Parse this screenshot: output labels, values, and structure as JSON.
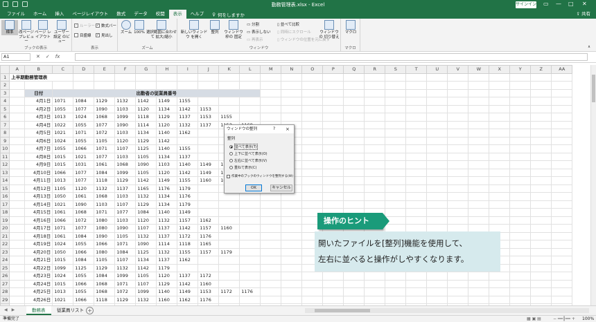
{
  "window": {
    "title": "勤務管理表.xlsx - Excel",
    "signin": "サインイン",
    "share": "共有"
  },
  "menu": {
    "tabs": [
      "ファイル",
      "ホーム",
      "挿入",
      "ページレイアウト",
      "数式",
      "データ",
      "校閲",
      "表示",
      "ヘルプ"
    ],
    "tellme": "何をしますか"
  },
  "ribbon": {
    "book_view": {
      "label": "ブックの表示",
      "normal": "標準",
      "page_break": "改ページ プレビュー",
      "page_layout": "ページ レイアウト",
      "custom": "ユーザー設定 のビュー"
    },
    "show": {
      "label": "表示",
      "ruler": "ルーラー",
      "formula_bar": "数式バー",
      "gridlines": "目盛線",
      "headings": "見出し"
    },
    "zoom": {
      "label": "ズーム",
      "zoom": "ズーム",
      "hundred": "100%",
      "to_selection": "選択範囲に合わせて 拡大/縮小"
    },
    "window": {
      "label": "ウィンドウ",
      "new_window": "新しいウィンドウ を開く",
      "arrange": "整列",
      "freeze": "ウィンドウ枠の 固定",
      "split": "分割",
      "hide": "表示しない",
      "unhide": "再表示",
      "side_by_side": "並べて比較",
      "sync_scroll": "同時にスクロール",
      "reset": "ウィンドウの位置を元に戻す",
      "switch": "ウィンドウの 切り替え"
    },
    "macro": {
      "label": "マクロ",
      "macro": "マクロ"
    }
  },
  "formula_bar": {
    "name_box": "A1",
    "fx": "fx"
  },
  "columns": [
    "A",
    "B",
    "C",
    "D",
    "E",
    "F",
    "G",
    "H",
    "I",
    "J",
    "K",
    "L",
    "M",
    "N",
    "O",
    "P",
    "Q",
    "R",
    "S",
    "T",
    "U",
    "V",
    "W",
    "X",
    "Y",
    "Z",
    "AA"
  ],
  "sheet": {
    "title": "上半期勤務管理表",
    "date_header": "日付",
    "ids_header": "出勤者の従業員番号",
    "rows": [
      {
        "date": "4月1日",
        "ids": [
          "1071",
          "1084",
          "1129",
          "1132",
          "1142",
          "1149",
          "1155",
          "",
          "",
          ""
        ]
      },
      {
        "date": "4月2日",
        "ids": [
          "1055",
          "1077",
          "1090",
          "1103",
          "1120",
          "1134",
          "1142",
          "1153",
          "",
          ""
        ]
      },
      {
        "date": "4月3日",
        "ids": [
          "1013",
          "1024",
          "1068",
          "1099",
          "1118",
          "1129",
          "1137",
          "1153",
          "1155",
          ""
        ]
      },
      {
        "date": "4月4日",
        "ids": [
          "1022",
          "1055",
          "1077",
          "1090",
          "1114",
          "1120",
          "1132",
          "1137",
          "1153",
          "1169"
        ]
      },
      {
        "date": "4月5日",
        "ids": [
          "1021",
          "1071",
          "1072",
          "1103",
          "1134",
          "1140",
          "1162",
          "",
          "",
          ""
        ]
      },
      {
        "date": "4月6日",
        "ids": [
          "1024",
          "1055",
          "1105",
          "1120",
          "1129",
          "1142",
          "",
          "",
          "",
          ""
        ]
      },
      {
        "date": "4月7日",
        "ids": [
          "1055",
          "1066",
          "1071",
          "1107",
          "1125",
          "1140",
          "1155",
          "",
          "",
          ""
        ]
      },
      {
        "date": "4月8日",
        "ids": [
          "1015",
          "1021",
          "1077",
          "1103",
          "1105",
          "1134",
          "1137",
          "",
          "",
          ""
        ]
      },
      {
        "date": "4月9日",
        "ids": [
          "1015",
          "1031",
          "1061",
          "1068",
          "1090",
          "1103",
          "1140",
          "1149",
          "1153",
          ""
        ]
      },
      {
        "date": "4月10日",
        "ids": [
          "1066",
          "1077",
          "1084",
          "1099",
          "1105",
          "1120",
          "1142",
          "1149",
          "1162",
          ""
        ]
      },
      {
        "date": "4月11日",
        "ids": [
          "1013",
          "1077",
          "1118",
          "1129",
          "1142",
          "1149",
          "1155",
          "1160",
          "1061",
          ""
        ]
      },
      {
        "date": "4月12日",
        "ids": [
          "1105",
          "1120",
          "1132",
          "1137",
          "1165",
          "1176",
          "1179",
          "",
          "",
          ""
        ]
      },
      {
        "date": "4月13日",
        "ids": [
          "1050",
          "1061",
          "1068",
          "1103",
          "1132",
          "1134",
          "1176",
          "",
          "",
          ""
        ]
      },
      {
        "date": "4月14日",
        "ids": [
          "1021",
          "1090",
          "1103",
          "1107",
          "1129",
          "1134",
          "1179",
          "",
          "",
          ""
        ]
      },
      {
        "date": "4月15日",
        "ids": [
          "1061",
          "1068",
          "1071",
          "1077",
          "1084",
          "1140",
          "1149",
          "",
          "",
          ""
        ]
      },
      {
        "date": "4月16日",
        "ids": [
          "1066",
          "1072",
          "1080",
          "1103",
          "1120",
          "1132",
          "1157",
          "1162",
          "",
          ""
        ]
      },
      {
        "date": "4月17日",
        "ids": [
          "1071",
          "1077",
          "1080",
          "1090",
          "1107",
          "1137",
          "1142",
          "1157",
          "1160",
          ""
        ]
      },
      {
        "date": "4月18日",
        "ids": [
          "1061",
          "1084",
          "1090",
          "1105",
          "1132",
          "1137",
          "1172",
          "1176",
          "",
          ""
        ]
      },
      {
        "date": "4月19日",
        "ids": [
          "1024",
          "1055",
          "1066",
          "1071",
          "1090",
          "1114",
          "1118",
          "1165",
          "",
          ""
        ]
      },
      {
        "date": "4月20日",
        "ids": [
          "1050",
          "1066",
          "1080",
          "1084",
          "1125",
          "1132",
          "1155",
          "1157",
          "1179",
          ""
        ]
      },
      {
        "date": "4月21日",
        "ids": [
          "1015",
          "1084",
          "1105",
          "1107",
          "1134",
          "1137",
          "1162",
          "",
          "",
          ""
        ]
      },
      {
        "date": "4月22日",
        "ids": [
          "1099",
          "1125",
          "1129",
          "1132",
          "1142",
          "1179",
          "",
          "",
          "",
          ""
        ]
      },
      {
        "date": "4月23日",
        "ids": [
          "1024",
          "1055",
          "1084",
          "1099",
          "1105",
          "1120",
          "1137",
          "1172",
          "",
          ""
        ]
      },
      {
        "date": "4月24日",
        "ids": [
          "1015",
          "1066",
          "1068",
          "1071",
          "1107",
          "1129",
          "1142",
          "1160",
          "",
          ""
        ]
      },
      {
        "date": "4月25日",
        "ids": [
          "1013",
          "1055",
          "1068",
          "1072",
          "1099",
          "1140",
          "1149",
          "1153",
          "1172",
          "1176"
        ]
      },
      {
        "date": "4月26日",
        "ids": [
          "1021",
          "1066",
          "1118",
          "1129",
          "1132",
          "1160",
          "1162",
          "1176",
          "",
          ""
        ]
      },
      {
        "date": "4月27日",
        "ids": [
          "1015",
          "1055",
          "1072",
          "1114",
          "1120",
          "1165",
          "1172",
          "",
          "",
          ""
        ]
      }
    ]
  },
  "dialog": {
    "title": "ウィンドウの整列",
    "help": "?",
    "close": "×",
    "section": "整列",
    "options": [
      "並べて表示(T)",
      "上下に並べて表示(O)",
      "左右に並べて表示(V)",
      "重ねて表示(C)"
    ],
    "checkbox": "作業中のブックのウィンドウを整列する(W)",
    "ok": "OK",
    "cancel": "キャンセル"
  },
  "sheet_tabs": {
    "active": "勤務表",
    "other": "従業員リスト"
  },
  "status": {
    "left": "準備完了",
    "zoom": "100%"
  },
  "hint": {
    "label": "操作のヒント",
    "line1": "開いたファイルを[整列]機能を使用して、",
    "line2": "左右に並べると操作がしやすくなります。"
  },
  "colors": {
    "excel_green": "#217346",
    "hint_green": "#1a9b7a",
    "hint_bg": "#d6eaed",
    "header_fill": "#d6dce4"
  }
}
